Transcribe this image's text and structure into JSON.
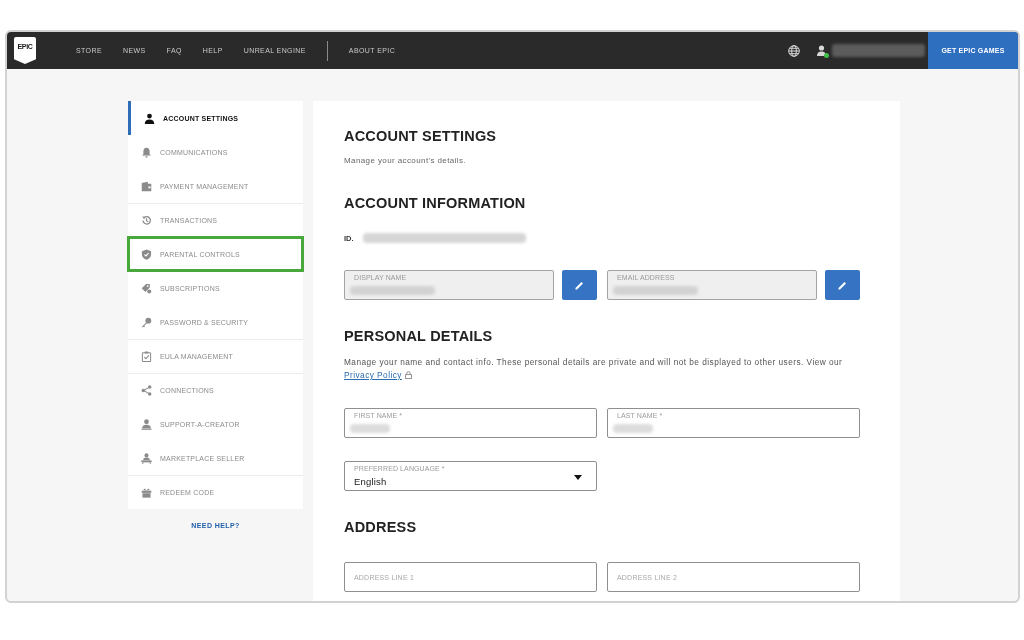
{
  "nav": {
    "logo": "EPIC",
    "links": [
      {
        "label": "STORE"
      },
      {
        "label": "NEWS"
      },
      {
        "label": "FAQ"
      },
      {
        "label": "HELP"
      },
      {
        "label": "UNREAL ENGINE"
      }
    ],
    "links_after_divider": [
      {
        "label": "ABOUT EPIC"
      }
    ],
    "user": {
      "online": true,
      "name_redacted": true
    },
    "cta": "GET EPIC GAMES"
  },
  "sidebar": {
    "groups": [
      {
        "items": [
          {
            "label": "ACCOUNT SETTINGS",
            "selected": true,
            "highlighted": false
          },
          {
            "label": "COMMUNICATIONS",
            "selected": false,
            "highlighted": false
          },
          {
            "label": "PAYMENT MANAGEMENT",
            "selected": false,
            "highlighted": false
          }
        ]
      },
      {
        "items": [
          {
            "label": "TRANSACTIONS",
            "selected": false,
            "highlighted": false
          },
          {
            "label": "PARENTAL CONTROLS",
            "selected": false,
            "highlighted": true
          },
          {
            "label": "SUBSCRIPTIONS",
            "selected": false,
            "highlighted": false
          },
          {
            "label": "PASSWORD & SECURITY",
            "selected": false,
            "highlighted": false
          }
        ]
      },
      {
        "items": [
          {
            "label": "EULA MANAGEMENT",
            "selected": false,
            "highlighted": false
          }
        ]
      },
      {
        "items": [
          {
            "label": "CONNECTIONS",
            "selected": false,
            "highlighted": false
          },
          {
            "label": "SUPPORT-A-CREATOR",
            "selected": false,
            "highlighted": false
          },
          {
            "label": "MARKETPLACE SELLER",
            "selected": false,
            "highlighted": false
          }
        ]
      },
      {
        "items": [
          {
            "label": "REDEEM CODE",
            "selected": false,
            "highlighted": false
          }
        ]
      }
    ],
    "help_link": "NEED HELP?"
  },
  "main": {
    "title": "ACCOUNT SETTINGS",
    "subtitle": "Manage your account's details.",
    "sections": [
      {
        "heading": "ACCOUNT INFORMATION",
        "id": {
          "label": "ID.",
          "value_redacted": true
        },
        "rows": [
          {
            "fields": [
              {
                "label": "DISPLAY NAME",
                "kind": "text",
                "disabled": true,
                "value_redacted": true,
                "edit_button": true
              },
              {
                "label": "EMAIL ADDRESS",
                "kind": "text",
                "disabled": true,
                "value_redacted": true,
                "edit_button": true
              }
            ]
          }
        ]
      },
      {
        "heading": "PERSONAL DETAILS",
        "description": {
          "text": "Manage your name and contact info. These personal details are private and will not be displayed to other users. View our",
          "link": "Privacy Policy"
        },
        "rows": [
          {
            "fields": [
              {
                "label": "FIRST NAME *",
                "kind": "text",
                "disabled": false,
                "value_redacted": true
              },
              {
                "label": "LAST NAME *",
                "kind": "text",
                "disabled": false,
                "value_redacted": true
              }
            ]
          },
          {
            "fields": [
              {
                "label": "PREFERRED LANGUAGE *",
                "kind": "select",
                "disabled": false,
                "value": "English"
              }
            ]
          }
        ]
      },
      {
        "heading": "ADDRESS",
        "rows": [
          {
            "fields": [
              {
                "placeholder": "ADDRESS LINE 1",
                "kind": "text",
                "disabled": false
              },
              {
                "placeholder": "ADDRESS LINE 2",
                "kind": "text",
                "disabled": false
              }
            ]
          }
        ]
      }
    ]
  }
}
